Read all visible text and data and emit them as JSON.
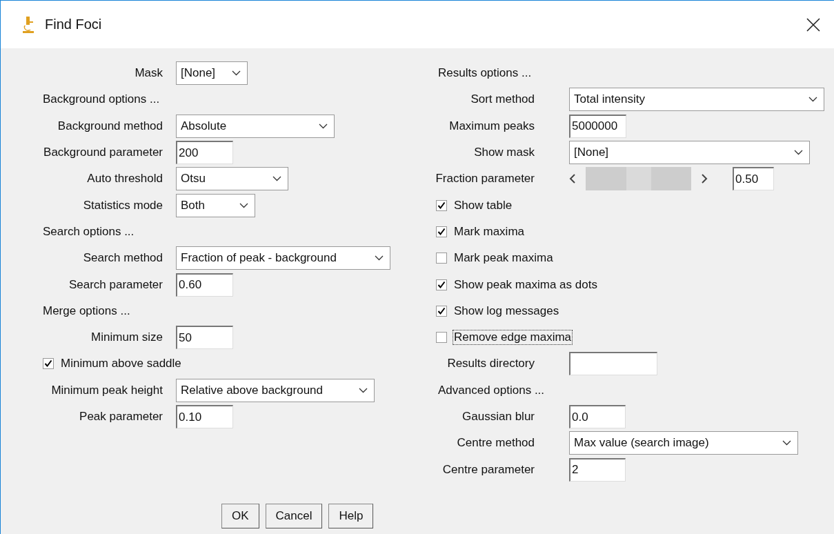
{
  "window": {
    "title": "Find Foci"
  },
  "left": [
    {
      "kind": "select",
      "label": "Mask",
      "value": "[None]"
    },
    {
      "kind": "heading",
      "label": "Background options ..."
    },
    {
      "kind": "select",
      "label": "Background method",
      "value": "Absolute"
    },
    {
      "kind": "field",
      "label": "Background parameter",
      "value": "200"
    },
    {
      "kind": "select",
      "label": "Auto threshold",
      "value": "Otsu"
    },
    {
      "kind": "select",
      "label": "Statistics mode",
      "value": "Both"
    },
    {
      "kind": "heading",
      "label": "Search options ..."
    },
    {
      "kind": "select",
      "label": "Search method",
      "value": "Fraction of peak - background"
    },
    {
      "kind": "field",
      "label": "Search parameter",
      "value": "0.60"
    },
    {
      "kind": "heading",
      "label": "Merge options ..."
    },
    {
      "kind": "field",
      "label": "Minimum size",
      "value": "50"
    },
    {
      "kind": "checkbox",
      "label": "Minimum above saddle",
      "checked": true,
      "focused": false
    },
    {
      "kind": "select",
      "label": "Minimum peak height",
      "value": "Relative above background"
    },
    {
      "kind": "field",
      "label": "Peak parameter",
      "value": "0.10"
    }
  ],
  "right": [
    {
      "kind": "heading",
      "label": "Results options ..."
    },
    {
      "kind": "select",
      "label": "Sort method",
      "value": "Total intensity"
    },
    {
      "kind": "field",
      "label": "Maximum peaks",
      "value": "5000000"
    },
    {
      "kind": "select",
      "label": "Show mask",
      "value": "[None]"
    },
    {
      "kind": "slider",
      "label": "Fraction parameter",
      "level": 0.5,
      "value": "0.50"
    },
    {
      "kind": "checkbox",
      "label": "Show table",
      "checked": true,
      "focused": false
    },
    {
      "kind": "checkbox",
      "label": "Mark maxima",
      "checked": true,
      "focused": false
    },
    {
      "kind": "checkbox",
      "label": "Mark peak maxima",
      "checked": false,
      "focused": false
    },
    {
      "kind": "checkbox",
      "label": "Show peak maxima as dots",
      "checked": true,
      "focused": false
    },
    {
      "kind": "checkbox",
      "label": "Show log messages",
      "checked": true,
      "focused": false
    },
    {
      "kind": "checkbox",
      "label": "Remove edge maxima",
      "checked": false,
      "focused": true
    },
    {
      "kind": "field",
      "label": "Results directory"
    },
    {
      "kind": "heading",
      "label": "Advanced options ..."
    },
    {
      "kind": "field",
      "label": "Gaussian blur",
      "value": "0.0"
    },
    {
      "kind": "select",
      "label": "Centre method",
      "value": "Max value (search image)"
    },
    {
      "kind": "field",
      "label": "Centre parameter",
      "value": "2"
    }
  ],
  "buttons": [
    "OK",
    "Cancel",
    "Help"
  ]
}
